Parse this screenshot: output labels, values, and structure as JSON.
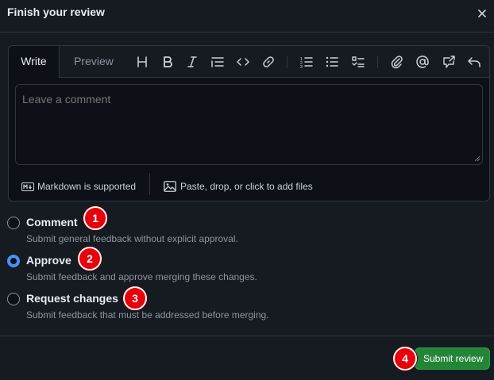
{
  "dialog": {
    "title": "Finish your review",
    "close_icon": "close-icon"
  },
  "editor": {
    "tabs": [
      {
        "label": "Write",
        "active": true
      },
      {
        "label": "Preview",
        "active": false
      }
    ],
    "toolbar_icons": [
      "heading-icon",
      "bold-icon",
      "italic-icon",
      "quote-icon",
      "code-icon",
      "link-icon",
      "ordered-list-icon",
      "unordered-list-icon",
      "task-list-icon",
      "attach-icon",
      "mention-icon",
      "reference-icon",
      "undo-icon"
    ],
    "placeholder": "Leave a comment",
    "markdown_label": "Markdown is supported",
    "attach_label": "Paste, drop, or click to add files"
  },
  "options": [
    {
      "label": "Comment",
      "description": "Submit general feedback without explicit approval.",
      "checked": false,
      "badge": "1"
    },
    {
      "label": "Approve",
      "description": "Submit feedback and approve merging these changes.",
      "checked": true,
      "badge": "2"
    },
    {
      "label": "Request changes",
      "description": "Submit feedback that must be addressed before merging.",
      "checked": false,
      "badge": "3"
    }
  ],
  "submit": {
    "label": "Submit review",
    "badge": "4"
  },
  "colors": {
    "background": "#161b22",
    "editor_bg": "#0d1117",
    "border": "#30363d",
    "accent_blue": "#4493f8",
    "submit_green": "#238636",
    "badge_red": "#e8000b"
  }
}
